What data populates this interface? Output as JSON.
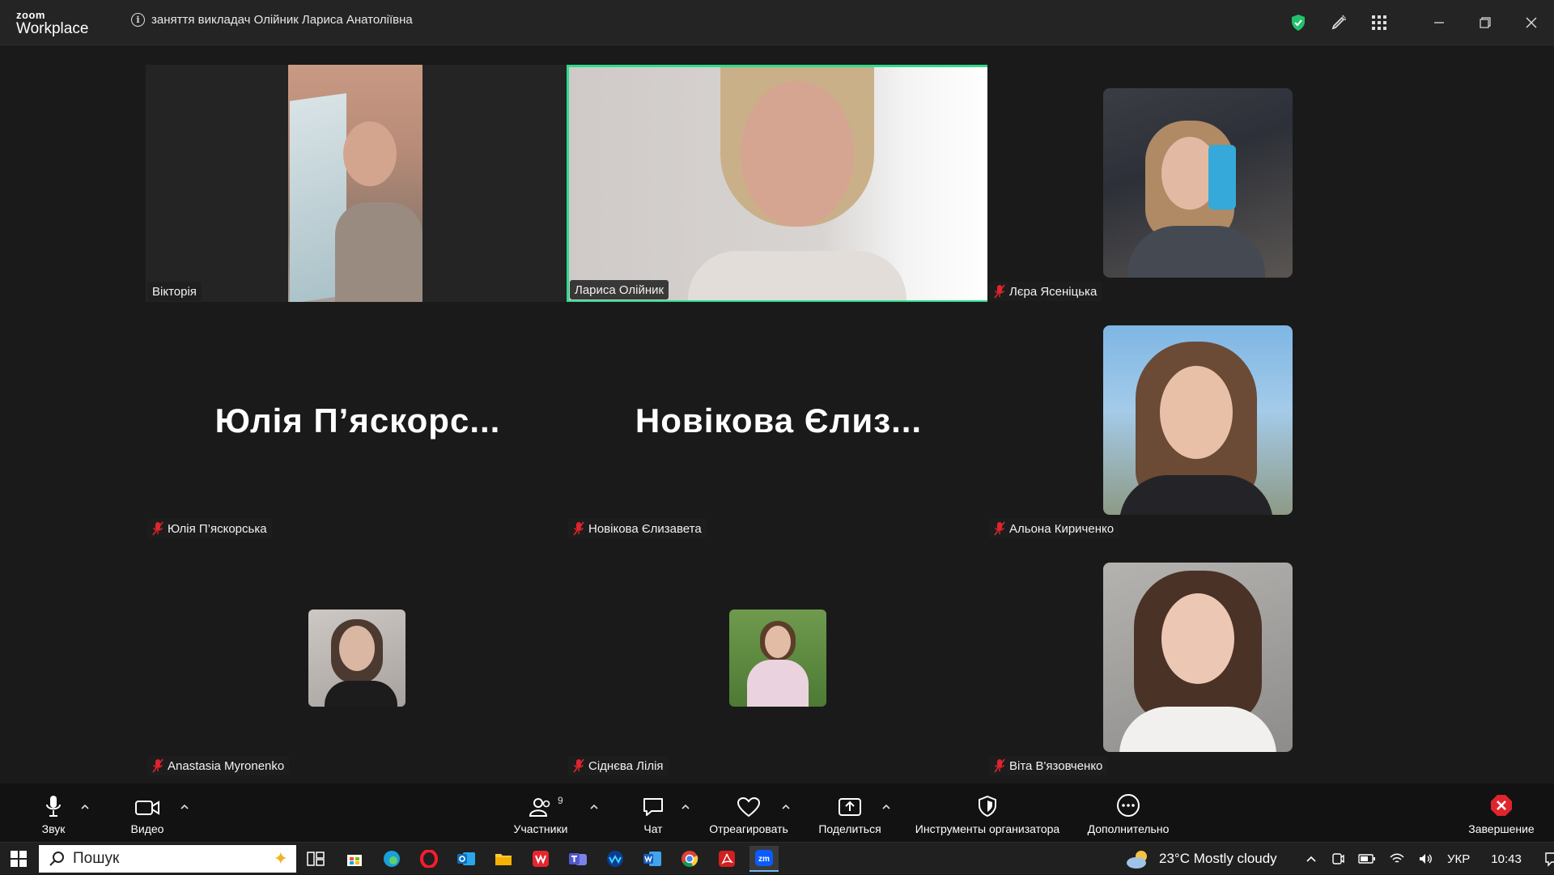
{
  "window": {
    "logo_zoom": "zoom",
    "logo_workplace": "Workplace",
    "meeting_title": "заняття викладач  Олійник Лариса Анатоліївна"
  },
  "participants": {
    "viktoria": "Вікторія",
    "larysa": "Лариса Олійник",
    "lera": "Лєра Ясеніцька",
    "yulia": "Юлія П’яскорська",
    "yulia_big": "Юлія  П’яскорс...",
    "novikova": "Новікова Єлизавета",
    "novikova_big": "Новікова Єлиз...",
    "alona": "Альона Кириченко",
    "anastasia": "Anastasia Myronenko",
    "sidneva": "Сіднєва Лілія",
    "vita": "Віта В'язовченко"
  },
  "toolbar": {
    "audio": "Звук",
    "video": "Видео",
    "participants": "Участники",
    "participants_count": "9",
    "chat": "Чат",
    "react": "Отреагировать",
    "share": "Поделиться",
    "host_tools": "Инструменты организатора",
    "more": "Дополнительно",
    "end": "Завершение"
  },
  "taskbar": {
    "search_placeholder": "Пошук",
    "weather": "23°C  Mostly cloudy",
    "language": "УКР",
    "time": "10:43"
  },
  "colors": {
    "active_speaker": "#2edc8c",
    "shield": "#21c16b",
    "end": "#e0242d",
    "muted": "#e0242d"
  }
}
